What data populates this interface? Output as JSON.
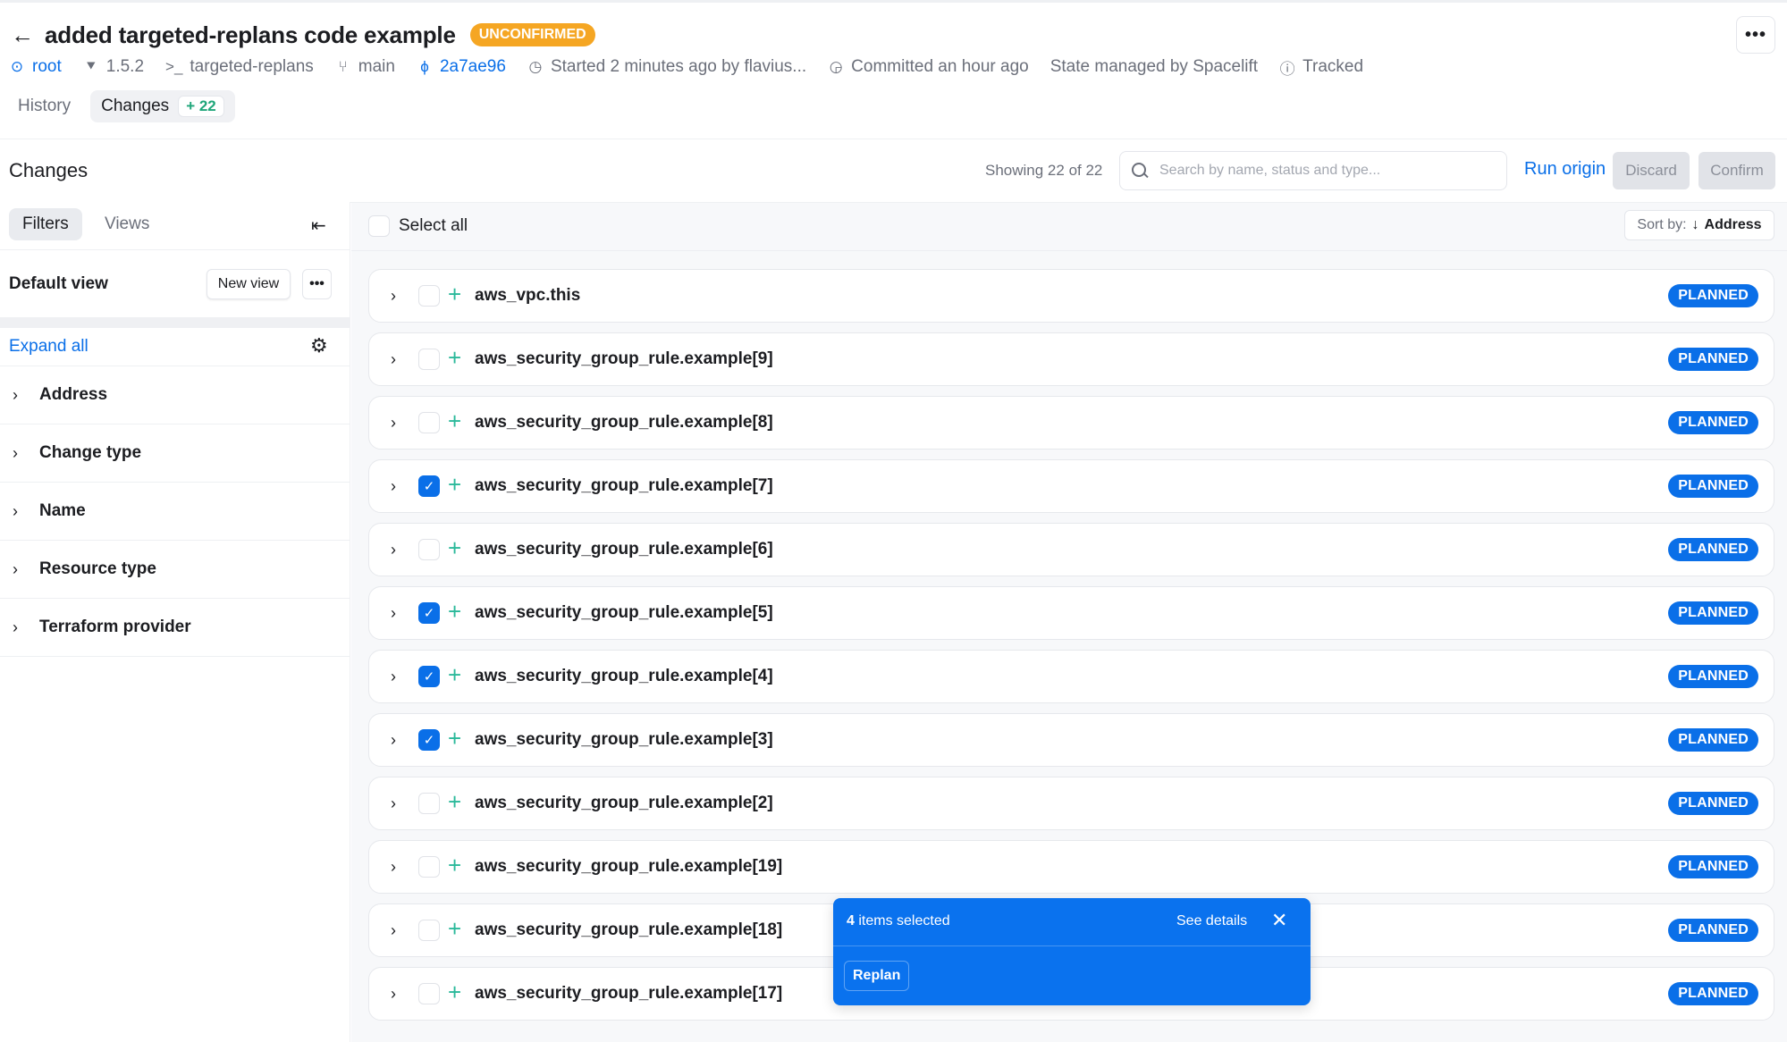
{
  "header": {
    "title": "added targeted-replans code example",
    "status_badge": "UNCONFIRMED",
    "more_label": "•••"
  },
  "meta": {
    "stack": "root",
    "terraform_version": "1.5.2",
    "project": "targeted-replans",
    "branch": "main",
    "commit": "2a7ae96",
    "started": "Started 2 minutes ago by flavius...",
    "committed": "Committed an hour ago",
    "state": "State managed by Spacelift",
    "tracked": "Tracked"
  },
  "tabs": [
    {
      "label": "History"
    },
    {
      "label": "Changes",
      "count": "+ 22"
    }
  ],
  "changes_bar": {
    "title": "Changes",
    "showing": "Showing 22 of 22",
    "search_placeholder": "Search by name, status and type...",
    "run_origin": "Run origin",
    "discard": "Discard",
    "confirm": "Confirm"
  },
  "sidebar": {
    "tabs": [
      {
        "label": "Filters"
      },
      {
        "label": "Views"
      }
    ],
    "default_view": "Default view",
    "new_view": "New view",
    "view_more": "•••",
    "expand_all": "Expand all",
    "filters": [
      {
        "label": "Address"
      },
      {
        "label": "Change type"
      },
      {
        "label": "Name"
      },
      {
        "label": "Resource type"
      },
      {
        "label": "Terraform provider"
      }
    ]
  },
  "list": {
    "select_all": "Select all",
    "sort_label": "Sort by:",
    "sort_value": "Address",
    "rows": [
      {
        "name": "aws_vpc.this",
        "checked": false,
        "status": "PLANNED"
      },
      {
        "name": "aws_security_group_rule.example[9]",
        "checked": false,
        "status": "PLANNED"
      },
      {
        "name": "aws_security_group_rule.example[8]",
        "checked": false,
        "status": "PLANNED"
      },
      {
        "name": "aws_security_group_rule.example[7]",
        "checked": true,
        "status": "PLANNED"
      },
      {
        "name": "aws_security_group_rule.example[6]",
        "checked": false,
        "status": "PLANNED"
      },
      {
        "name": "aws_security_group_rule.example[5]",
        "checked": true,
        "status": "PLANNED"
      },
      {
        "name": "aws_security_group_rule.example[4]",
        "checked": true,
        "status": "PLANNED"
      },
      {
        "name": "aws_security_group_rule.example[3]",
        "checked": true,
        "status": "PLANNED"
      },
      {
        "name": "aws_security_group_rule.example[2]",
        "checked": false,
        "status": "PLANNED"
      },
      {
        "name": "aws_security_group_rule.example[19]",
        "checked": false,
        "status": "PLANNED"
      },
      {
        "name": "aws_security_group_rule.example[18]",
        "checked": false,
        "status": "PLANNED"
      },
      {
        "name": "aws_security_group_rule.example[17]",
        "checked": false,
        "status": "PLANNED"
      }
    ]
  },
  "selection_toast": {
    "count": "4",
    "count_suffix": " items selected",
    "see_details": "See details",
    "replan": "Replan"
  },
  "colors": {
    "accent": "#0a6fe8",
    "unconfirmed": "#f5a623",
    "create_plus": "#2bb99a"
  }
}
